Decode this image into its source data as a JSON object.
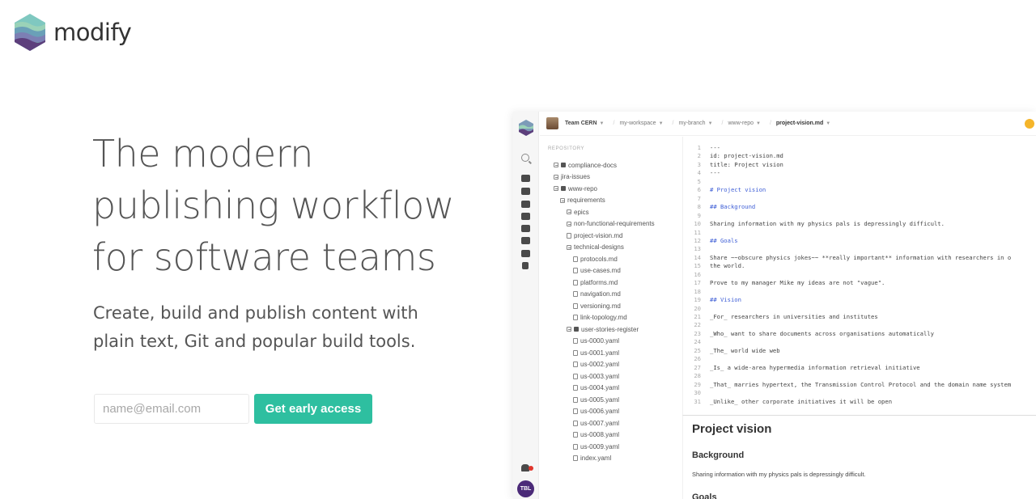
{
  "brand": {
    "name": "modify",
    "logo_icon": "layered-waves-hexagon-logo"
  },
  "hero": {
    "title_lines": [
      "The modern",
      "publishing workflow",
      "for software teams"
    ],
    "subtitle_lines": [
      "Create, build and publish content with",
      "plain text, Git and popular build tools."
    ]
  },
  "signup": {
    "email_placeholder": "name@email.com",
    "email_value": "",
    "button_label": "Get early access",
    "button_color": "#2ebfa0"
  },
  "app": {
    "topbar": {
      "team": "Team CERN",
      "breadcrumbs": [
        "my-workspace",
        "my-branch",
        "www-repo"
      ],
      "current_file": "project-vision.md"
    },
    "rail": {
      "avatar_initials": "TBL",
      "avatar_color": "#4b2a78"
    },
    "repository": {
      "heading": "REPOSITORY",
      "items": [
        {
          "label": "compliance-docs",
          "icon": "folder-icon"
        },
        {
          "label": "jira-issues",
          "icon": "folder-icon"
        },
        {
          "label": "www-repo",
          "icon": "folder-icon"
        },
        {
          "label": "requirements",
          "icon": "folder-icon"
        },
        {
          "label": "epics",
          "icon": "folder-icon"
        },
        {
          "label": "non-functional-requirements",
          "icon": "folder-icon"
        },
        {
          "label": "project-vision.md",
          "icon": "file-icon"
        },
        {
          "label": "technical-designs",
          "icon": "folder-icon"
        },
        {
          "label": "protocols.md",
          "icon": "file-icon"
        },
        {
          "label": "use-cases.md",
          "icon": "file-icon"
        },
        {
          "label": "platforms.md",
          "icon": "file-icon"
        },
        {
          "label": "navigation.md",
          "icon": "file-icon"
        },
        {
          "label": "versioning.md",
          "icon": "file-icon"
        },
        {
          "label": "link-topology.md",
          "icon": "file-icon"
        },
        {
          "label": "user-stories-register",
          "icon": "table-icon"
        },
        {
          "label": "us-0000.yaml",
          "icon": "file-icon"
        },
        {
          "label": "us-0001.yaml",
          "icon": "file-icon"
        },
        {
          "label": "us-0002.yaml",
          "icon": "file-icon"
        },
        {
          "label": "us-0003.yaml",
          "icon": "file-icon"
        },
        {
          "label": "us-0004.yaml",
          "icon": "file-icon"
        },
        {
          "label": "us-0005.yaml",
          "icon": "file-icon"
        },
        {
          "label": "us-0006.yaml",
          "icon": "file-icon"
        },
        {
          "label": "us-0007.yaml",
          "icon": "file-icon"
        },
        {
          "label": "us-0008.yaml",
          "icon": "file-icon"
        },
        {
          "label": "us-0009.yaml",
          "icon": "file-icon"
        },
        {
          "label": "index.yaml",
          "icon": "file-icon"
        }
      ]
    },
    "editor": {
      "lines": [
        {
          "n": "1",
          "text": "---"
        },
        {
          "n": "2",
          "text": "id: project-vision.md"
        },
        {
          "n": "3",
          "text": "title: Project vision"
        },
        {
          "n": "4",
          "text": "---"
        },
        {
          "n": "5",
          "text": ""
        },
        {
          "n": "6",
          "text": "# Project vision"
        },
        {
          "n": "7",
          "text": ""
        },
        {
          "n": "8",
          "text": "## Background"
        },
        {
          "n": "9",
          "text": ""
        },
        {
          "n": "10",
          "text": "Sharing information with my physics pals is depressingly difficult."
        },
        {
          "n": "11",
          "text": ""
        },
        {
          "n": "12",
          "text": "## Goals"
        },
        {
          "n": "13",
          "text": ""
        },
        {
          "n": "14",
          "text": "Share ~~obscure physics jokes~~ **really important** information with researchers in o"
        },
        {
          "n": "15",
          "text": "the world."
        },
        {
          "n": "16",
          "text": ""
        },
        {
          "n": "17",
          "text": "Prove to my manager Mike my ideas are not \"vague\"."
        },
        {
          "n": "18",
          "text": ""
        },
        {
          "n": "19",
          "text": "## Vision"
        },
        {
          "n": "20",
          "text": ""
        },
        {
          "n": "21",
          "text": "_For_ researchers in universities and institutes"
        },
        {
          "n": "22",
          "text": ""
        },
        {
          "n": "23",
          "text": "_Who_ want to share documents across organisations automatically"
        },
        {
          "n": "24",
          "text": ""
        },
        {
          "n": "25",
          "text": "_The_ world wide web"
        },
        {
          "n": "26",
          "text": ""
        },
        {
          "n": "27",
          "text": "_Is_ a wide-area hypermedia information retrieval initiative"
        },
        {
          "n": "28",
          "text": ""
        },
        {
          "n": "29",
          "text": "_That_ marries hypertext, the Transmission Control Protocol and the domain name system"
        },
        {
          "n": "30",
          "text": ""
        },
        {
          "n": "31",
          "text": "_Unlike_ other corporate initiatives it will be open"
        }
      ]
    },
    "preview": {
      "title": "Project vision",
      "background_heading": "Background",
      "background_text": "Sharing information with my physics pals is depressingly difficult.",
      "goals_heading": "Goals"
    }
  }
}
